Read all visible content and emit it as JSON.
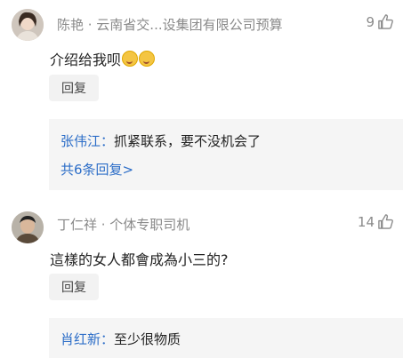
{
  "comments": [
    {
      "author": "陈艳 · 云南省交...设集团有限公司预算",
      "likes": "9",
      "text": "介绍给我呗",
      "reply_label": "回复",
      "replies": [
        {
          "name": "张伟江：",
          "text": "抓紧联系，要不没机会了"
        }
      ],
      "more_replies": "共6条回复>"
    },
    {
      "author": "丁仁祥 · 个体专职司机",
      "likes": "14",
      "text": "這樣的女人都會成為小三的?",
      "reply_label": "回复",
      "replies": [
        {
          "name": "肖红新：",
          "text": "至少很物质"
        }
      ]
    }
  ]
}
